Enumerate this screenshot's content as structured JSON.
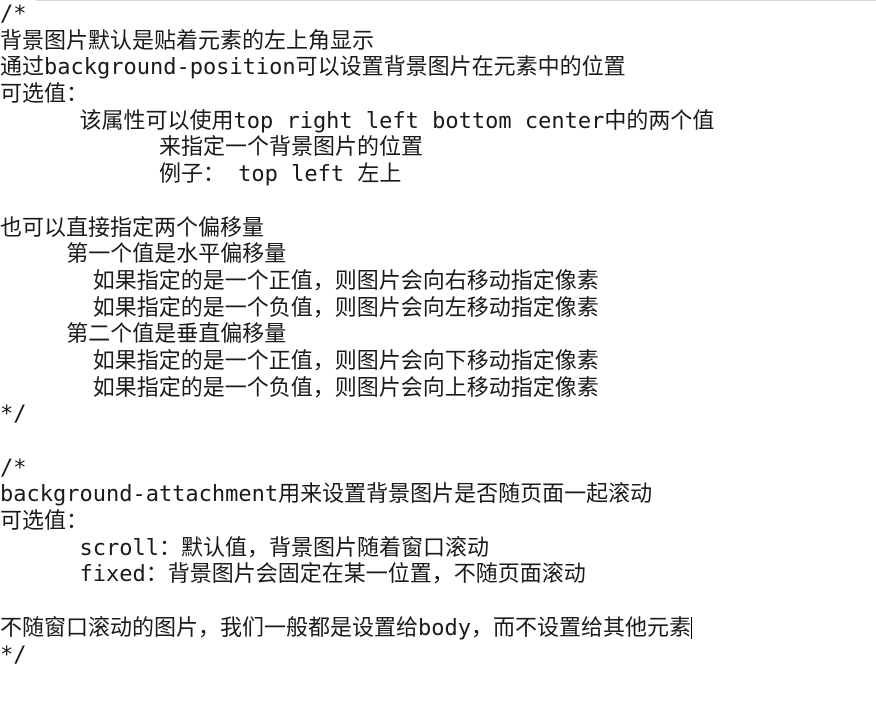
{
  "editor": {
    "lines": [
      "/*",
      "背景图片默认是贴着元素的左上角显示",
      "通过background-position可以设置背景图片在元素中的位置",
      "可选值：",
      "      该属性可以使用top right left bottom center中的两个值",
      "            来指定一个背景图片的位置",
      "            例子： top left 左上",
      "",
      "也可以直接指定两个偏移量",
      "     第一个值是水平偏移量",
      "       如果指定的是一个正值，则图片会向右移动指定像素",
      "       如果指定的是一个负值，则图片会向左移动指定像素",
      "     第二个值是垂直偏移量",
      "       如果指定的是一个正值，则图片会向下移动指定像素",
      "       如果指定的是一个负值，则图片会向上移动指定像素",
      "*/",
      "",
      "/*",
      "background-attachment用来设置背景图片是否随页面一起滚动",
      "可选值：",
      "      scroll：默认值，背景图片随着窗口滚动",
      "      fixed：背景图片会固定在某一位置，不随页面滚动",
      "",
      "不随窗口滚动的图片，我们一般都是设置给body，而不设置给其他元素",
      "*/"
    ],
    "caret_line": 23
  }
}
